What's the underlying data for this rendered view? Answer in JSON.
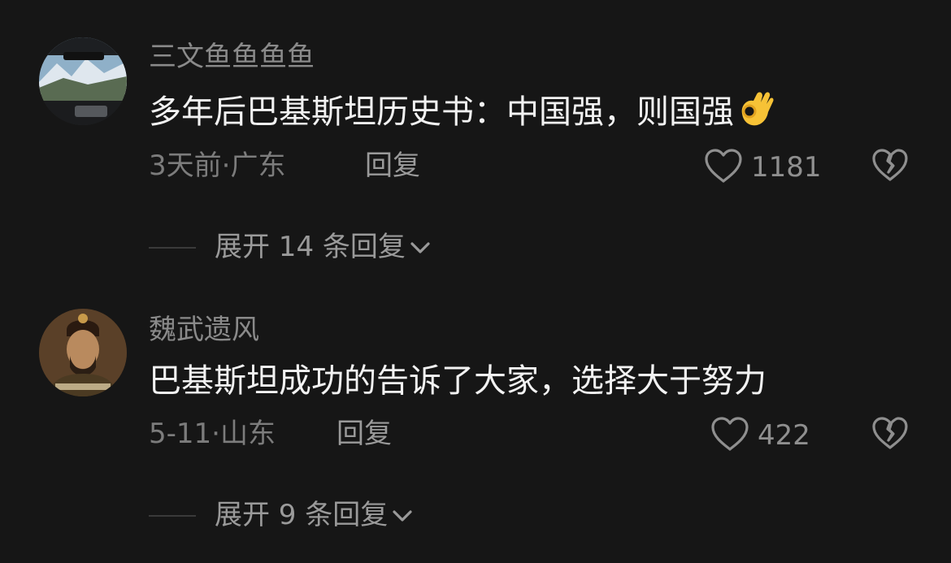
{
  "comments": [
    {
      "username": "三文鱼鱼鱼鱼",
      "text": "多年后巴基斯坦历史书：中国强，则国强",
      "emoji": "ok-hand-emoji",
      "time_location": "3天前·广东",
      "reply_label": "回复",
      "likes": "1181",
      "expand_label": "展开 14 条回复"
    },
    {
      "username": "魏武遗风",
      "text": "巴基斯坦成功的告诉了大家，选择大于努力",
      "time_location": "5-11·山东",
      "reply_label": "回复",
      "likes": "422",
      "expand_label": "展开 9 条回复"
    }
  ],
  "icons": {
    "like": "heart-outline-icon",
    "dislike": "broken-heart-icon",
    "expand": "chevron-down-icon"
  },
  "colors": {
    "background": "#161616",
    "username": "#8a8a8a",
    "content": "#f2f2f2",
    "meta": "#7c7c7c"
  }
}
